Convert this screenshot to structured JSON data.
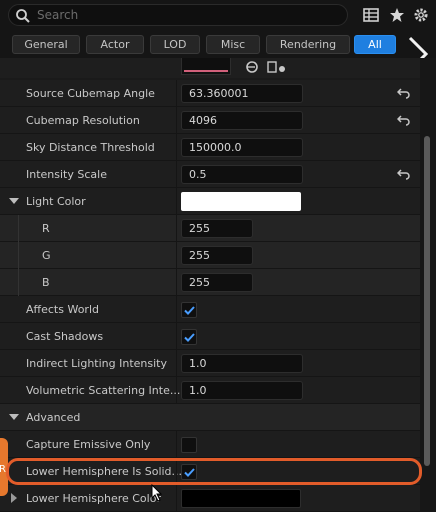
{
  "search": {
    "placeholder": "Search"
  },
  "toolbar": {
    "icons": [
      "table-view-icon",
      "favorite-star-icon",
      "settings-gear-icon"
    ]
  },
  "tabs": [
    {
      "label": "General",
      "active": false
    },
    {
      "label": "Actor",
      "active": false
    },
    {
      "label": "LOD",
      "active": false
    },
    {
      "label": "Misc",
      "active": false
    },
    {
      "label": "Rendering",
      "active": false
    },
    {
      "label": "All",
      "active": true
    }
  ],
  "properties": {
    "source_cubemap_angle": {
      "label": "Source Cubemap Angle",
      "value": "63.360001"
    },
    "cubemap_resolution": {
      "label": "Cubemap Resolution",
      "value": "4096"
    },
    "sky_distance_threshold": {
      "label": "Sky Distance Threshold",
      "value": "150000.0"
    },
    "intensity_scale": {
      "label": "Intensity Scale",
      "value": "0.5"
    },
    "light_color": {
      "label": "Light Color",
      "swatch_color": "#ffffff",
      "r": {
        "label": "R",
        "value": "255"
      },
      "g": {
        "label": "G",
        "value": "255"
      },
      "b": {
        "label": "B",
        "value": "255"
      }
    },
    "affects_world": {
      "label": "Affects World",
      "checked": true
    },
    "cast_shadows": {
      "label": "Cast Shadows",
      "checked": true
    },
    "indirect_lighting_intensity": {
      "label": "Indirect Lighting Intensity",
      "value": "1.0"
    },
    "volumetric_scattering": {
      "label": "Volumetric Scattering Inte...",
      "value": "1.0"
    },
    "advanced": {
      "label": "Advanced"
    },
    "capture_emissive_only": {
      "label": "Capture Emissive Only",
      "checked": false
    },
    "lower_hemisphere_is_solid": {
      "label": "Lower Hemisphere Is Solid...",
      "checked": true
    },
    "lower_hemisphere_color": {
      "label": "Lower Hemisphere Color",
      "swatch_color": "#000000"
    }
  },
  "annotation": {
    "side_marker_text": "R",
    "highlight_color": "#e25c2a"
  }
}
